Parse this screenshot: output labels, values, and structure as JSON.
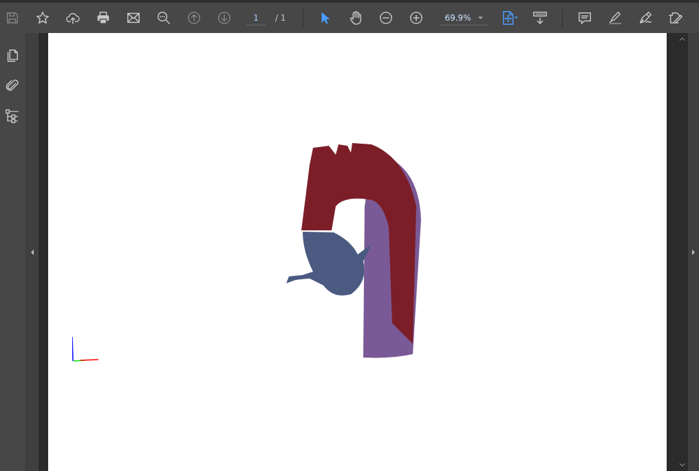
{
  "toolbar": {
    "tools_left": [
      {
        "kind": "save",
        "disabled": true
      },
      {
        "kind": "bookmark",
        "disabled": false
      },
      {
        "kind": "upload",
        "disabled": false
      },
      {
        "kind": "print",
        "disabled": false
      },
      {
        "kind": "email",
        "disabled": false
      },
      {
        "kind": "find",
        "disabled": false
      },
      {
        "kind": "previous-page",
        "disabled": true
      },
      {
        "kind": "next-page",
        "disabled": true
      }
    ],
    "page_number": "1",
    "page_total": "/ 1",
    "tools_middle": [
      {
        "kind": "select",
        "selected": true
      },
      {
        "kind": "hand",
        "selected": false
      },
      {
        "kind": "zoom-out",
        "selected": false
      },
      {
        "kind": "zoom-in",
        "selected": false
      }
    ],
    "zoom": "69.9%",
    "tools_right": [
      {
        "kind": "fit-page"
      },
      {
        "kind": "scroll-mode"
      }
    ],
    "tools_end": [
      {
        "kind": "comment"
      },
      {
        "kind": "highlight"
      },
      {
        "kind": "sign"
      },
      {
        "kind": "edit"
      }
    ]
  },
  "sidebar": {
    "items": [
      {
        "kind": "pages"
      },
      {
        "kind": "attachments"
      },
      {
        "kind": "layers"
      }
    ]
  }
}
